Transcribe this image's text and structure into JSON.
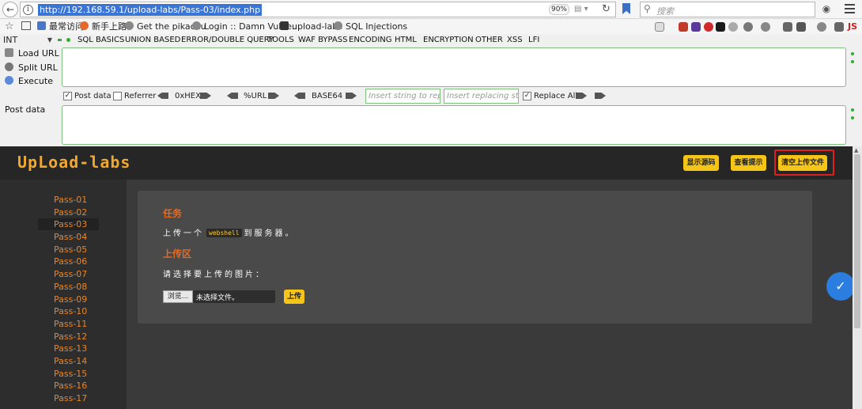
{
  "browser": {
    "url": "http://192.168.59.1/upload-labs/Pass-03/index.php",
    "zoom": "90%",
    "search_placeholder": "搜索"
  },
  "bookmarks": [
    {
      "label": "最常访问",
      "icon": "bookmark-folder-icon",
      "color": "#4a78c8"
    },
    {
      "label": "新手上路",
      "icon": "firefox-icon",
      "color": "#e8682a"
    },
    {
      "label": "Get the pikachu",
      "icon": "globe-icon",
      "color": "#888888"
    },
    {
      "label": "Login :: Damn Vulne...",
      "icon": "globe-icon",
      "color": "#888888"
    },
    {
      "label": "upload-labs",
      "icon": "folder-icon",
      "color": "#333333"
    },
    {
      "label": "SQL Injections",
      "icon": "globe-icon",
      "color": "#888888"
    }
  ],
  "hackbar": {
    "select_value": "INT",
    "menu": [
      "SQL BASICS",
      "UNION BASED",
      "ERROR/DOUBLE QUERY",
      "TOOLS",
      "WAF BYPASS",
      "ENCODING",
      "HTML",
      "ENCRYPTION",
      "OTHER",
      "XSS",
      "LFI"
    ],
    "load_url": "Load URL",
    "split_url": "Split URL",
    "execute": "Execute",
    "post_data_label": "Post data",
    "opt_post_data": "Post data",
    "opt_referrer": "Referrer",
    "opt_hex": "0xHEX",
    "opt_url": "%URL",
    "opt_base64": "BASE64",
    "replace_find_placeholder": "Insert string to replace",
    "replace_with_placeholder": "Insert replacing string",
    "opt_replace_all": "Replace All"
  },
  "site": {
    "logo": "UpLoad-labs",
    "btn_show_source": "显示源码",
    "btn_show_hint": "查看提示",
    "btn_clear_uploads": "清空上传文件",
    "passes": [
      "Pass-01",
      "Pass-02",
      "Pass-03",
      "Pass-04",
      "Pass-05",
      "Pass-06",
      "Pass-07",
      "Pass-08",
      "Pass-09",
      "Pass-10",
      "Pass-11",
      "Pass-12",
      "Pass-13",
      "Pass-14",
      "Pass-15",
      "Pass-16",
      "Pass-17"
    ],
    "active_pass": "Pass-03",
    "task_heading": "任务",
    "task_pre": "上传一个",
    "task_code": "webshell",
    "task_post": "到服务器。",
    "upload_heading": "上传区",
    "upload_prompt": "请选择要上传的图片：",
    "browse_btn": "浏览...",
    "file_status": "未选择文件。",
    "upload_btn": "上传"
  },
  "colors": {
    "accent_orange": "#e8862a",
    "button_yellow": "#f5c518",
    "highlight_red": "#e02020"
  }
}
